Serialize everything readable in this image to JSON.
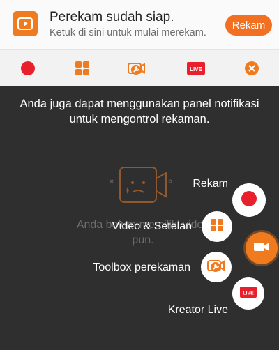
{
  "notification": {
    "title": "Perekam sudah siap.",
    "subtitle": "Ketuk di sini untuk mulai merekam.",
    "button_label": "Rekam",
    "accent_color": "#f27022"
  },
  "action_bar": {
    "items": [
      {
        "icon": "record-icon"
      },
      {
        "icon": "grid-icon"
      },
      {
        "icon": "toolbox-icon"
      },
      {
        "icon": "live-icon",
        "badge": "LIVE"
      },
      {
        "icon": "close-icon"
      }
    ]
  },
  "overlay": {
    "hint_line1": "Anda juga dapat menggunakan panel notifikasi",
    "hint_line2": "untuk mengontrol rekaman.",
    "background_text_line1": "Anda belum memiliki video",
    "background_text_line2": "pun."
  },
  "floating_menu": {
    "items": [
      {
        "label": "Rekam",
        "icon": "record-icon"
      },
      {
        "label": "Video & Setelan",
        "icon": "grid-icon"
      },
      {
        "label": "Toolbox perekaman",
        "icon": "toolbox-icon"
      },
      {
        "label": "Kreator Live",
        "icon": "live-icon",
        "badge": "LIVE"
      }
    ],
    "main_button_icon": "camera-icon"
  }
}
